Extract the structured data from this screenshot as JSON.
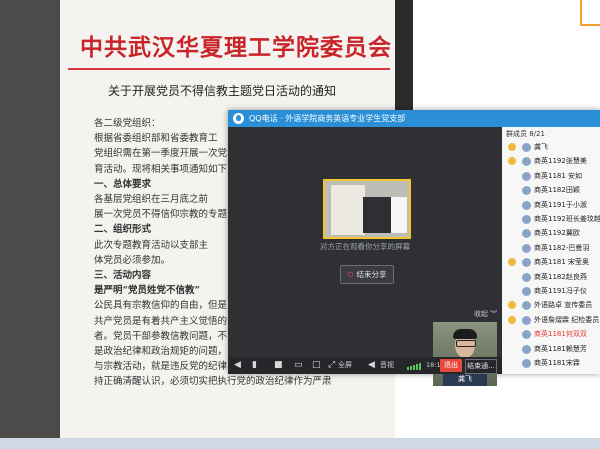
{
  "paper": {
    "header": "中共武汉华夏理工学院委员会",
    "title": "关于开展党员不得信教主题党日活动的通知",
    "lines": [
      "各二级党组织：",
      "    根据省委组织部和省委教育工",
      "党组织需在第一季度开展一次党",
      "育活动。现将相关事项通知如下：",
      "    一、总体要求",
      "    各基层党组织在三月底之前",
      "展一次党员不得信仰宗教的专题",
      "    二、组织形式",
      "    此次专题教育活动以支部主",
      "体党员必须参加。",
      "    三、活动内容",
      "    是严明“党员姓党不信教”",
      "公民具有宗教信仰的自由，但是",
      "共产党员是有着共产主义觉悟的",
      "者。党员干部参教信教问题，不",
      "是政治纪律和政治规矩的问题，",
      "与宗教活动，就是违反党的纪律",
      "持正确清醒认识，必须切实把执行党的政治纪律作为严肃"
    ]
  },
  "qq": {
    "title": "QQ电话 · 外语学院商务英语专业学生党支部",
    "watching_text": "对方正在观看你分享的屏幕",
    "end_share": "结束分享",
    "collapse": "收起",
    "self_name": "龚飞",
    "toolbar": {
      "fullscreen": "全屏",
      "audio": "音视",
      "time": "18:11",
      "hangup": "退出",
      "end_meeting": "结束通..."
    },
    "members_title": "群成员 8/21",
    "members": [
      {
        "name": "龚飞",
        "role": "#f0b93a",
        "red": false
      },
      {
        "name": "商英1192张慧美",
        "role": "#f0b93a",
        "red": false
      },
      {
        "name": "商英1181 安如",
        "role": "",
        "red": false
      },
      {
        "name": "商英1182田颖",
        "role": "",
        "red": false
      },
      {
        "name": "商英1191于小淑",
        "role": "",
        "red": false
      },
      {
        "name": "商英1192班长姜玟越",
        "role": "",
        "red": false
      },
      {
        "name": "商英1192翼欧",
        "role": "",
        "red": false
      },
      {
        "name": "商英1182-巴曼羽",
        "role": "",
        "red": false
      },
      {
        "name": "商英1181 宋莹奥",
        "role": "#f0b93a",
        "red": false
      },
      {
        "name": "商英1182赵良燕",
        "role": "",
        "red": false
      },
      {
        "name": "商英1191冯子仪",
        "role": "",
        "red": false
      },
      {
        "name": "外语路卓  宣传委员",
        "role": "#f0b93a",
        "red": false
      },
      {
        "name": "外语詹熠霖  纪检委员",
        "role": "#f0b93a",
        "red": false
      },
      {
        "name": "商英1181何双双",
        "role": "",
        "red": true
      },
      {
        "name": "商英1181赖慧芳",
        "role": "",
        "red": false
      },
      {
        "name": "商英1181宋霖",
        "role": "",
        "red": false
      }
    ]
  }
}
